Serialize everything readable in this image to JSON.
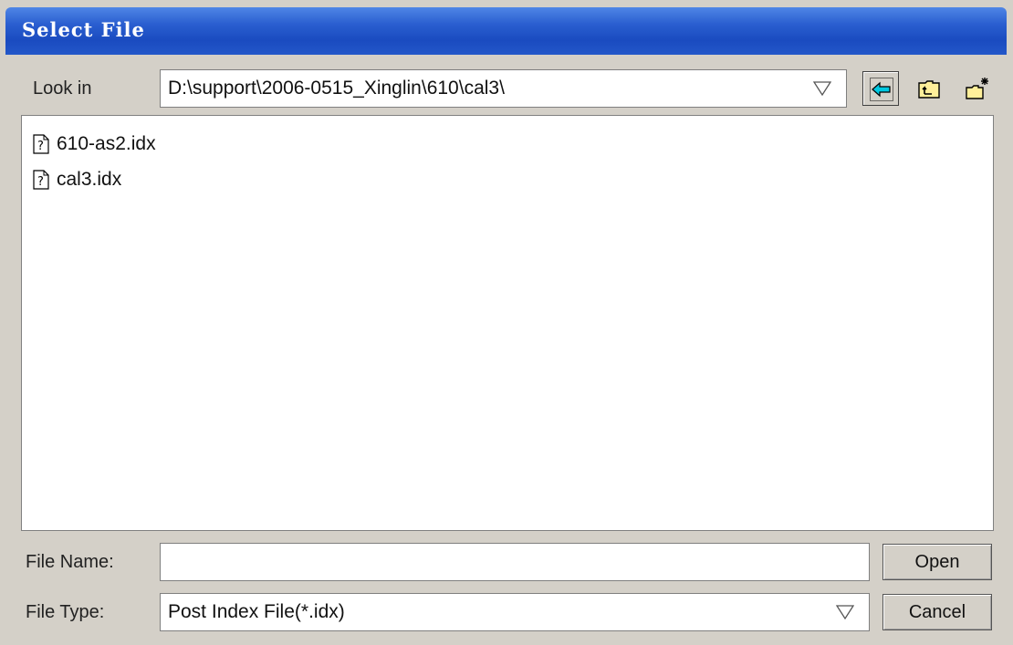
{
  "window": {
    "title": "Select File"
  },
  "lookin": {
    "label": "Look in",
    "path": "D:\\support\\2006-0515_Xinglin\\610\\cal3\\"
  },
  "toolbar": {
    "back_icon": "back-arrow-icon",
    "up_icon": "up-folder-icon",
    "new_folder_icon": "new-folder-icon"
  },
  "files": [
    {
      "name": "610-as2.idx",
      "icon": "unknown-file-icon"
    },
    {
      "name": "cal3.idx",
      "icon": "unknown-file-icon"
    }
  ],
  "filename": {
    "label": "File Name:",
    "value": ""
  },
  "filetype": {
    "label": "File Type:",
    "value": "Post Index File(*.idx)"
  },
  "buttons": {
    "open": "Open",
    "cancel": "Cancel"
  },
  "colors": {
    "titlebar": "#2a5fd0",
    "dialog_bg": "#d4d0c8",
    "back_arrow": "#00c8e0"
  }
}
